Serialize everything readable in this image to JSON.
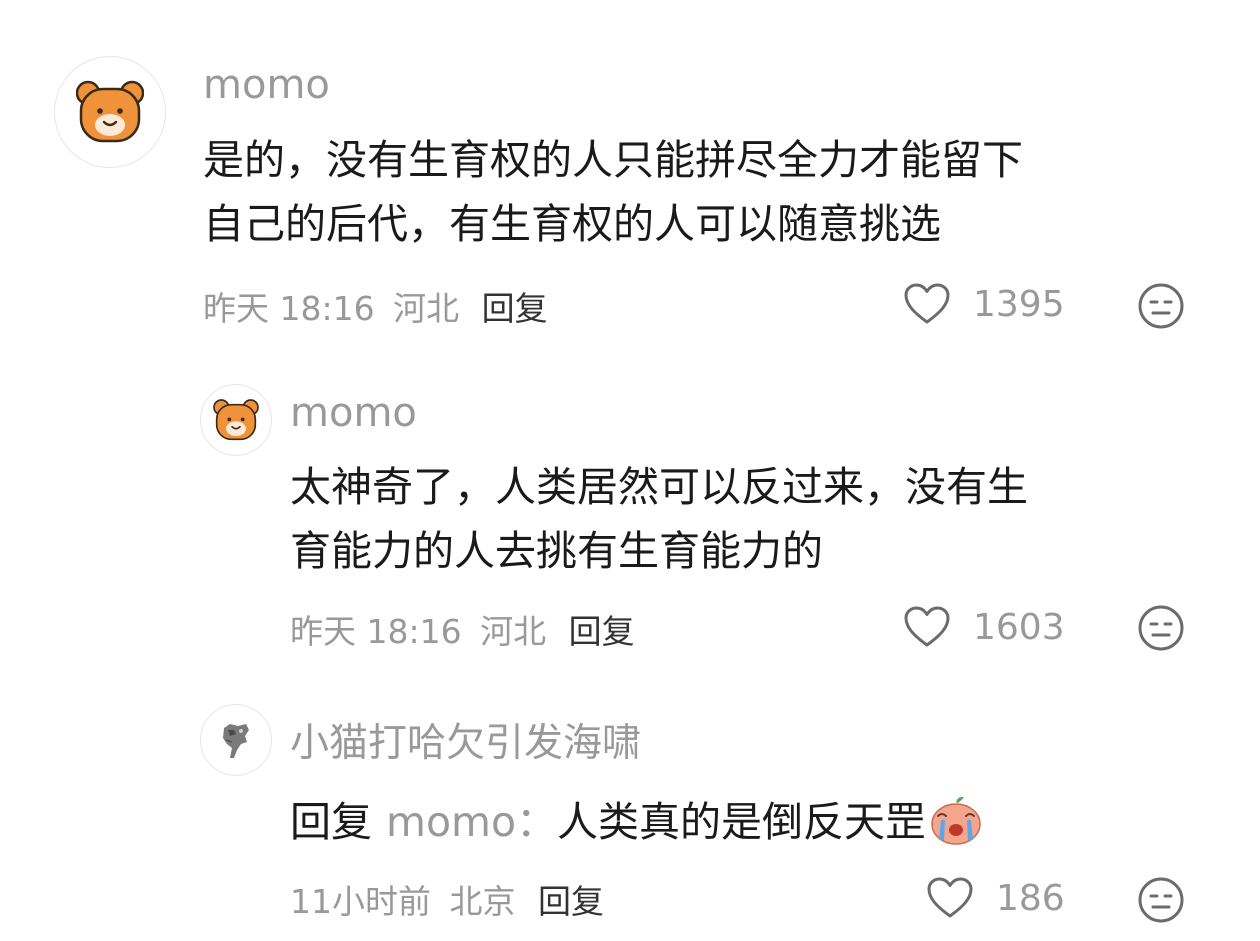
{
  "comments": [
    {
      "user": "momo",
      "text_line1": "是的，没有生育权的人只能拼尽全力才能留下",
      "text_line2": "自己的后代，有生育权的人可以随意挑选",
      "time": "昨天 18:16",
      "location": "河北",
      "reply_label": "回复",
      "likes": "1395",
      "avatar_icon": "bear-avatar-icon"
    },
    {
      "user": "momo",
      "text_line1": "太神奇了，人类居然可以反过来，没有生",
      "text_line2": "育能力的人去挑有生育能力的",
      "time": "昨天 18:16",
      "location": "河北",
      "reply_label": "回复",
      "likes": "1603",
      "avatar_icon": "bear-avatar-icon"
    },
    {
      "user": "小猫打哈欠引发海啸",
      "reply_prefix": "回复",
      "reply_to": "momo：",
      "text": "人类真的是倒反天罡",
      "time": "11小时前",
      "location": "北京",
      "reply_label": "回复",
      "likes": "186",
      "avatar_icon": "cat-sketch-avatar-icon",
      "inline_emoji": "crying-peach-emoji-icon"
    }
  ],
  "colors": {
    "text": "#1a1a1a",
    "muted": "#999999",
    "bear_orange": "#f0923a",
    "icon_gray": "#6b6b6b"
  }
}
